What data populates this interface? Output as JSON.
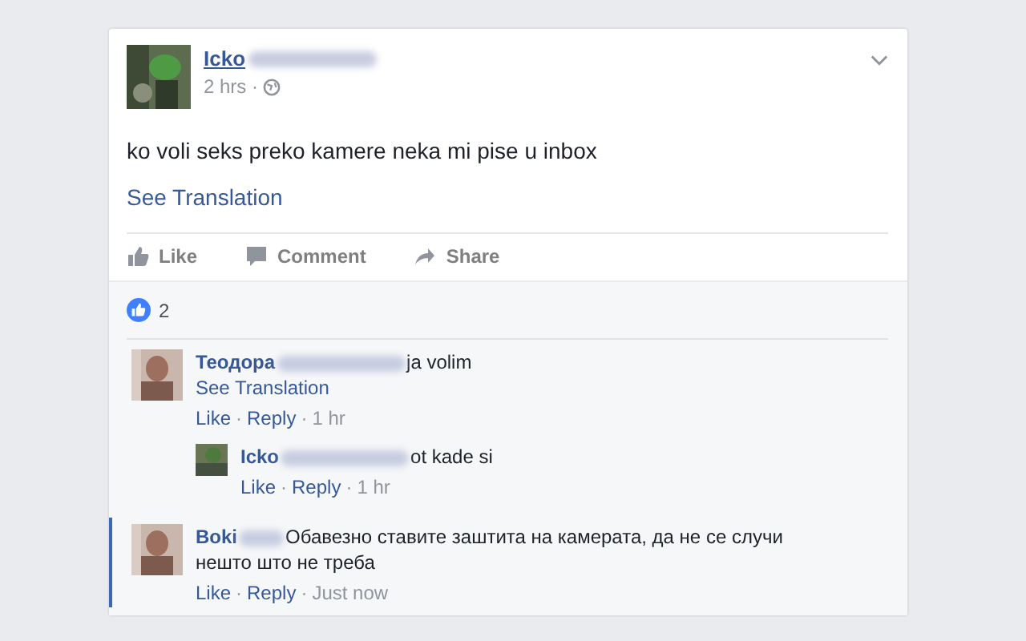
{
  "post": {
    "author": "Icko",
    "time": "2 hrs",
    "separator": "·",
    "text": "ko voli seks preko kamere neka mi pise u inbox",
    "see_translation": "See Translation",
    "actions": [
      {
        "kind": "like",
        "label": "Like"
      },
      {
        "kind": "comment",
        "label": "Comment"
      },
      {
        "kind": "share",
        "label": "Share"
      }
    ],
    "likes": "2"
  },
  "comments": [
    {
      "author": "Теодора",
      "text": "ja volim",
      "see_translation": "See Translation",
      "actions": [
        "Like",
        "Reply"
      ],
      "separator": "·",
      "time": "1 hr",
      "highlighted": false,
      "children": [
        {
          "author": "Icko",
          "text": "ot kade si",
          "actions": [
            "Like",
            "Reply"
          ],
          "separator": "·",
          "time": "1 hr"
        }
      ]
    },
    {
      "author": "Boki",
      "text": "Обавезно ставите заштита на камерата, да не се случи нешто што не треба",
      "actions": [
        "Like",
        "Reply"
      ],
      "separator": "·",
      "time": "Just now",
      "highlighted": true
    }
  ]
}
